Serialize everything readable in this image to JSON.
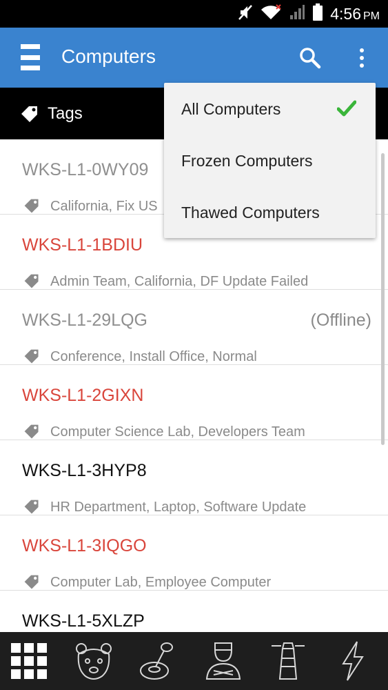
{
  "status_bar": {
    "time": "4:56",
    "ampm": "PM"
  },
  "app_bar": {
    "title": "Computers"
  },
  "tags_bar": {
    "label": "Tags"
  },
  "computers": [
    {
      "name": "WKS-L1-0WY09",
      "tags": "California, Fix US",
      "status": "",
      "color": "gray"
    },
    {
      "name": "WKS-L1-1BDIU",
      "tags": "Admin Team, California, DF Update Failed",
      "status": "",
      "color": "red"
    },
    {
      "name": "WKS-L1-29LQG",
      "tags": "Conference, Install Office, Normal",
      "status": "(Offline)",
      "color": "gray"
    },
    {
      "name": "WKS-L1-2GIXN",
      "tags": "Computer Science Lab, Developers Team",
      "status": "",
      "color": "red"
    },
    {
      "name": "WKS-L1-3HYP8",
      "tags": "HR Department, Laptop, Software Update",
      "status": "",
      "color": "black"
    },
    {
      "name": "WKS-L1-3IQGO",
      "tags": "Computer Lab, Employee Computer",
      "status": "",
      "color": "red"
    },
    {
      "name": "WKS-L1-5XLZP",
      "tags": "",
      "status": "",
      "color": "black"
    }
  ],
  "filter_menu": {
    "items": [
      {
        "label": "All Computers",
        "selected": true
      },
      {
        "label": "Frozen Computers",
        "selected": false
      },
      {
        "label": "Thawed Computers",
        "selected": false
      }
    ]
  },
  "bottom_nav": {
    "icons": [
      "grid-icon",
      "bear-icon",
      "joystick-icon",
      "admin-icon",
      "lighthouse-icon",
      "lightning-icon"
    ]
  },
  "colors": {
    "app_bar": "#3a83cf",
    "red_name": "#d9453b",
    "gray_name": "#8f8f8f",
    "check": "#3ab53a",
    "bottom_nav": "#1e1e1e"
  }
}
